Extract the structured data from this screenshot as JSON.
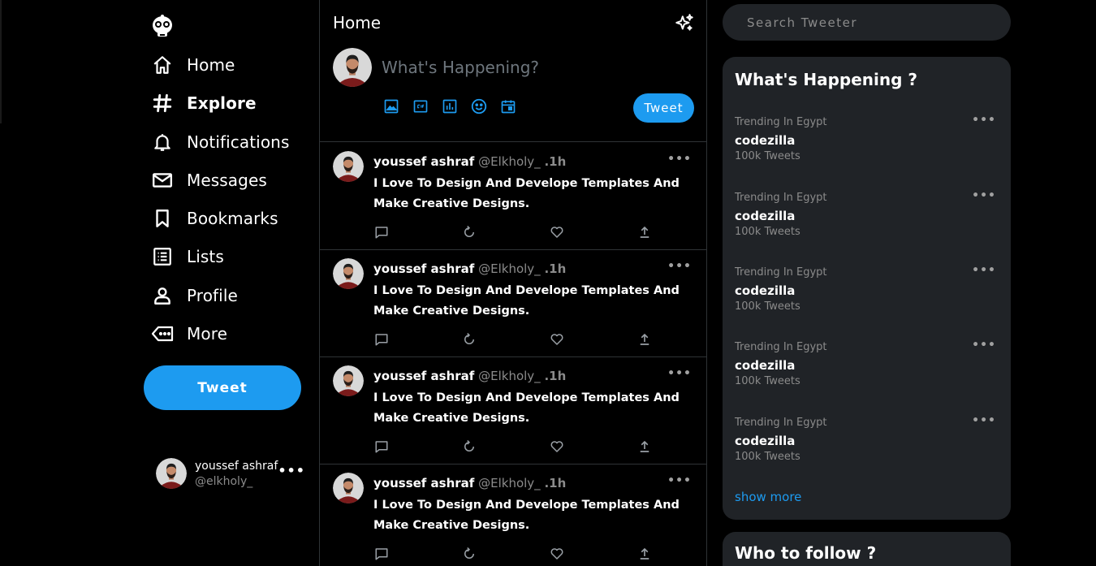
{
  "colors": {
    "accent": "#1d9bf0",
    "panel": "#202327",
    "muted": "#8b8b8b"
  },
  "sidebar": {
    "logo": "robot-logo-icon",
    "items": [
      {
        "label": "Home",
        "icon": "home-icon"
      },
      {
        "label": "Explore",
        "icon": "hashtag-icon"
      },
      {
        "label": "Notifications",
        "icon": "bell-icon"
      },
      {
        "label": "Messages",
        "icon": "mail-icon"
      },
      {
        "label": "Bookmarks",
        "icon": "bookmark-icon"
      },
      {
        "label": "Lists",
        "icon": "list-icon"
      },
      {
        "label": "Profile",
        "icon": "person-icon"
      },
      {
        "label": "More",
        "icon": "more-icon"
      }
    ],
    "tweet_button": "Tweet",
    "user": {
      "name": "youssef ashraf",
      "handle": "@elkholy_"
    }
  },
  "feed": {
    "title": "Home",
    "compose": {
      "placeholder": "What's Happening?",
      "button": "Tweet"
    },
    "tweets": [
      {
        "name": "youssef ashraf",
        "handle": "@Elkholy_",
        "time": ".1h",
        "text": "I Love To Design And Develope Templates And Make Creative Designs."
      },
      {
        "name": "youssef ashraf",
        "handle": "@Elkholy_",
        "time": ".1h",
        "text": "I Love To Design And Develope Templates And Make Creative Designs."
      },
      {
        "name": "youssef ashraf",
        "handle": "@Elkholy_",
        "time": ".1h",
        "text": "I Love To Design And Develope Templates And Make Creative Designs."
      },
      {
        "name": "youssef ashraf",
        "handle": "@Elkholy_",
        "time": ".1h",
        "text": "I Love To Design And Develope Templates And Make Creative Designs."
      }
    ]
  },
  "right": {
    "search_placeholder": "Search Tweeter",
    "happening": {
      "title": "What's Happening ?",
      "trends": [
        {
          "sub": "Trending In Egypt",
          "topic": "codezilla",
          "count": "100k Tweets"
        },
        {
          "sub": "Trending In Egypt",
          "topic": "codezilla",
          "count": "100k Tweets"
        },
        {
          "sub": "Trending In Egypt",
          "topic": "codezilla",
          "count": "100k Tweets"
        },
        {
          "sub": "Trending In Egypt",
          "topic": "codezilla",
          "count": "100k Tweets"
        },
        {
          "sub": "Trending In Egypt",
          "topic": "codezilla",
          "count": "100k Tweets"
        }
      ],
      "show_more": "show more"
    },
    "follow": {
      "title": "Who to follow ?"
    }
  }
}
